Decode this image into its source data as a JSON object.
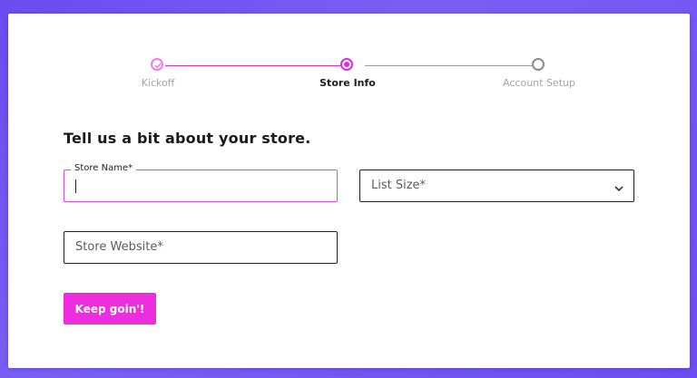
{
  "stepper": {
    "steps": [
      {
        "label": "Kickoff",
        "state": "done"
      },
      {
        "label": "Store Info",
        "state": "active"
      },
      {
        "label": "Account Setup",
        "state": "todo"
      }
    ]
  },
  "form": {
    "heading": "Tell us a bit about your store.",
    "store_name": {
      "label": "Store Name*",
      "value": ""
    },
    "list_size": {
      "placeholder": "List Size*",
      "icon": "chevron-down-icon"
    },
    "store_website": {
      "placeholder": "Store Website*"
    },
    "submit_label": "Keep goin'!"
  },
  "colors": {
    "accent": "#ee2ddf",
    "background": "#6a4cf0"
  }
}
